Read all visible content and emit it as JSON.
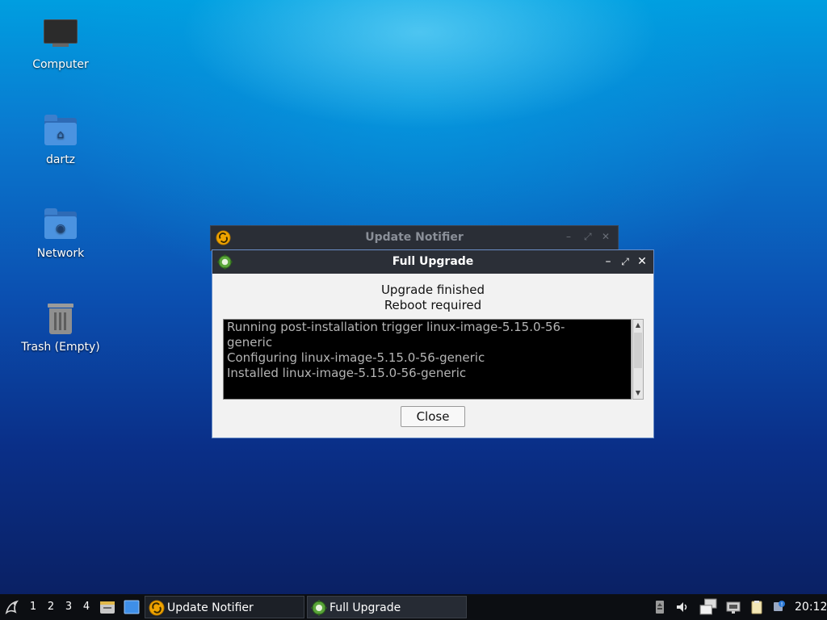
{
  "desktop": {
    "icons": [
      {
        "label": "Computer",
        "icon": "computer-icon"
      },
      {
        "label": "dartz",
        "icon": "home-folder-icon"
      },
      {
        "label": "Network",
        "icon": "network-folder-icon"
      },
      {
        "label": "Trash (Empty)",
        "icon": "trash-icon"
      }
    ]
  },
  "back_window": {
    "title": "Update Notifier",
    "icon": "update-notifier-icon"
  },
  "dialog": {
    "title": "Full Upgrade",
    "icon": "gear-icon",
    "message_line1": "Upgrade finished",
    "message_line2": "Reboot required",
    "log_lines": [
      "Running post-installation trigger linux-image-5.15.0-56-",
      "generic",
      "Configuring linux-image-5.15.0-56-generic",
      "Installed linux-image-5.15.0-56-generic"
    ],
    "close_label": "Close",
    "controls": {
      "minimize": "–",
      "maximize": "⤢",
      "close": "✕"
    }
  },
  "taskbar": {
    "workspaces": [
      "1",
      "2",
      "3",
      "4"
    ],
    "tasks": [
      {
        "label": "Update Notifier",
        "icon": "update-notifier-icon"
      },
      {
        "label": "Full Upgrade",
        "icon": "gear-icon"
      }
    ],
    "clock": "20:12"
  },
  "colors": {
    "accent": "#6b8fc7",
    "titlebar": "#2b2f37",
    "taskbar": "#0c0e12"
  }
}
